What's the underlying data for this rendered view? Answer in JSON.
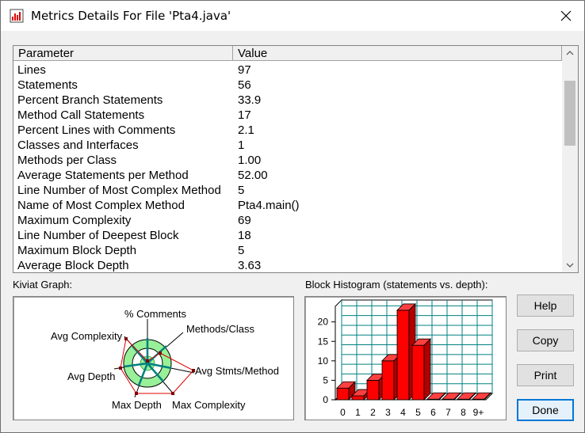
{
  "window": {
    "title": "Metrics Details For File 'Pta4.java'"
  },
  "table": {
    "headers": [
      "Parameter",
      "Value"
    ],
    "rows": [
      [
        "Lines",
        "97"
      ],
      [
        "Statements",
        "56"
      ],
      [
        "Percent Branch Statements",
        "33.9"
      ],
      [
        "Method Call Statements",
        "17"
      ],
      [
        "Percent Lines with Comments",
        "2.1"
      ],
      [
        "Classes and Interfaces",
        "1"
      ],
      [
        "Methods per Class",
        "1.00"
      ],
      [
        "Average Statements per Method",
        "52.00"
      ],
      [
        "Line Number of Most Complex Method",
        "5"
      ],
      [
        "Name of Most Complex Method",
        "Pta4.main()"
      ],
      [
        "Maximum Complexity",
        "69"
      ],
      [
        "Line Number of Deepest Block",
        "18"
      ],
      [
        "Maximum Block Depth",
        "5"
      ],
      [
        "Average Block Depth",
        "3.63"
      ]
    ]
  },
  "kiviat": {
    "label": "Kiviat Graph:",
    "axes": [
      "% Comments",
      "Methods/Class",
      "Avg Stmts/Method",
      "Max Complexity",
      "Max Depth",
      "Avg Depth",
      "Avg Complexity"
    ]
  },
  "histogram": {
    "label": "Block Histogram (statements vs. depth):",
    "chart_data": {
      "type": "bar",
      "categories": [
        "0",
        "1",
        "2",
        "3",
        "4",
        "5",
        "6",
        "7",
        "8",
        "9+"
      ],
      "values": [
        3,
        1,
        5,
        10,
        23,
        14,
        0,
        0,
        0,
        0
      ],
      "ylim": [
        0,
        24
      ],
      "yticks": [
        "0",
        "5",
        "10",
        "15",
        "20"
      ],
      "grid": true,
      "bar_color": "#ff0000"
    }
  },
  "buttons": {
    "help": "Help",
    "copy": "Copy",
    "print": "Print",
    "done": "Done"
  }
}
